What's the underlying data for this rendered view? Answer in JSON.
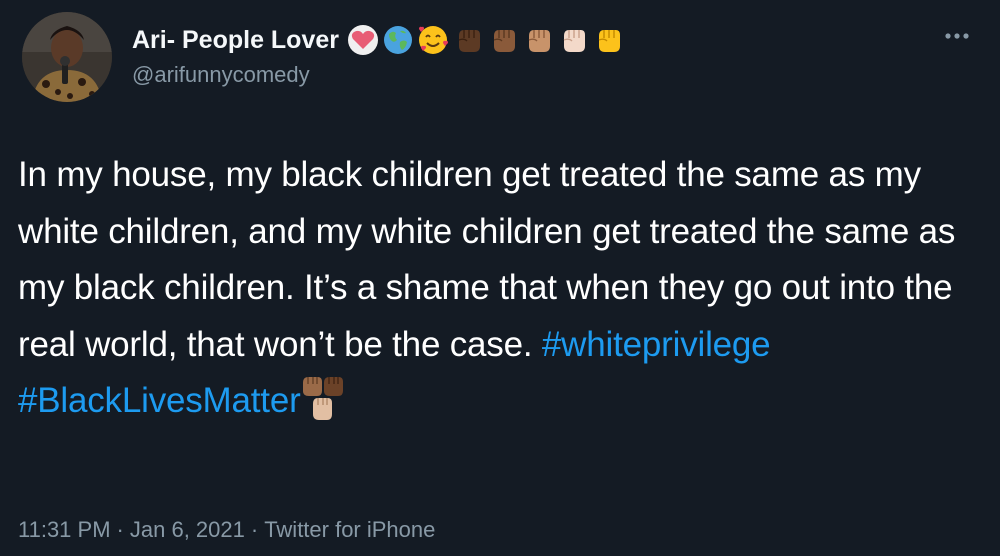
{
  "user": {
    "display_name": "Ari- People Lover",
    "handle": "@arifunnycomedy",
    "name_emojis": [
      "heart-emoji",
      "globe-earth-emoji",
      "smiling-hearts-emoji",
      "raised-fist-dark-emoji",
      "raised-fist-medium-dark-emoji",
      "raised-fist-medium-emoji",
      "raised-fist-light-emoji",
      "raised-fist-yellow-emoji"
    ]
  },
  "tweet": {
    "text_before": "In my house, my black children get treated the same as my white children, and my white children get treated the same as my black children. It’s a shame that when they go out into the real world, that won’t be the case. ",
    "hashtag_1": "#whiteprivilege",
    "hashtag_2": "#BlackLivesMatter",
    "trailing_emoji": "raised-fists-emoji"
  },
  "meta": {
    "time": "11:31 PM",
    "date": "Jan 6, 2021",
    "source": "Twitter for iPhone",
    "separator": "·"
  },
  "colors": {
    "background": "#141b24",
    "text": "#ffffff",
    "secondary_text": "#8899a6",
    "link": "#1d9bf0"
  }
}
